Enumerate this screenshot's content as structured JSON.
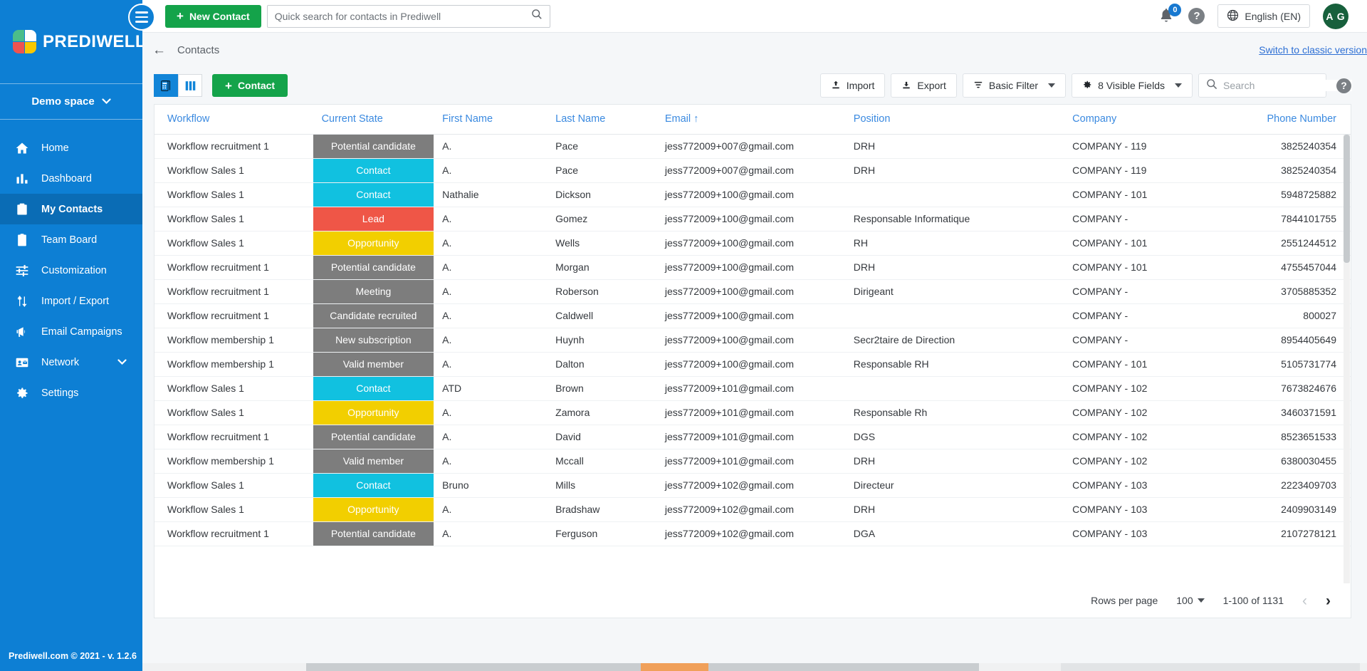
{
  "brand": {
    "name": "PREDIWELL",
    "space": "Demo space",
    "version": "Prediwell.com © 2021 - v. 1.2.6"
  },
  "topbar": {
    "new_contact_label": "New Contact",
    "quick_search_placeholder": "Quick search for contacts in Prediwell",
    "notification_count": "0",
    "help_label": "?",
    "language": "English (EN)",
    "avatar_initials": "A G"
  },
  "breadcrumb": {
    "label": "Contacts",
    "classic_link": "Switch to classic version"
  },
  "sidebar": {
    "items": [
      {
        "label": "Home",
        "icon": "home-icon",
        "active": false
      },
      {
        "label": "Dashboard",
        "icon": "chart-bar-icon",
        "active": false
      },
      {
        "label": "My Contacts",
        "icon": "contacts-board-icon",
        "active": true
      },
      {
        "label": "Team Board",
        "icon": "clipboard-icon",
        "active": false
      },
      {
        "label": "Customization",
        "icon": "sliders-icon",
        "active": false
      },
      {
        "label": "Import / Export",
        "icon": "import-export-icon",
        "active": false
      },
      {
        "label": "Email Campaigns",
        "icon": "megaphone-icon",
        "active": false
      },
      {
        "label": "Network",
        "icon": "contact-card-icon",
        "active": false,
        "caret": true
      },
      {
        "label": "Settings",
        "icon": "gear-icon",
        "active": false
      }
    ]
  },
  "toolbar": {
    "add_contact_label": "Contact",
    "import_label": "Import",
    "export_label": "Export",
    "basic_filter_label": "Basic Filter",
    "visible_fields_label": "8 Visible Fields",
    "search_placeholder": "Search",
    "help_label": "?"
  },
  "table": {
    "columns": [
      {
        "key": "workflow",
        "label": "Workflow"
      },
      {
        "key": "state",
        "label": "Current State"
      },
      {
        "key": "first",
        "label": "First Name"
      },
      {
        "key": "last",
        "label": "Last Name"
      },
      {
        "key": "email",
        "label": "Email",
        "sort": "↑"
      },
      {
        "key": "position",
        "label": "Position"
      },
      {
        "key": "company",
        "label": "Company"
      },
      {
        "key": "phone",
        "label": "Phone Number"
      }
    ],
    "state_colors": {
      "Potential candidate": "#7d7d7d",
      "Contact": "#11c1e0",
      "Lead": "#ef5647",
      "Opportunity": "#f2cf00",
      "Meeting": "#7d7d7d",
      "Candidate recruited": "#7d7d7d",
      "New subscription": "#7d7d7d",
      "Valid member": "#7d7d7d"
    },
    "rows": [
      {
        "workflow": "Workflow recruitment 1",
        "state": "Potential candidate",
        "state_class": "gray",
        "first": "A.",
        "last": "Pace",
        "email": "jess772009+007@gmail.com",
        "position": "DRH",
        "company": "COMPANY - 119",
        "phone": "3825240354"
      },
      {
        "workflow": "Workflow Sales 1",
        "state": "Contact",
        "state_class": "cyan",
        "first": "A.",
        "last": "Pace",
        "email": "jess772009+007@gmail.com",
        "position": "DRH",
        "company": "COMPANY - 119",
        "phone": "3825240354"
      },
      {
        "workflow": "Workflow Sales 1",
        "state": "Contact",
        "state_class": "cyan",
        "first": "Nathalie",
        "last": "Dickson",
        "email": "jess772009+100@gmail.com",
        "position": "",
        "company": "COMPANY - 101",
        "phone": "5948725882"
      },
      {
        "workflow": "Workflow Sales 1",
        "state": "Lead",
        "state_class": "red",
        "first": "A.",
        "last": "Gomez",
        "email": "jess772009+100@gmail.com",
        "position": "Responsable Informatique",
        "company": "COMPANY - ",
        "phone": "7844101755"
      },
      {
        "workflow": "Workflow Sales 1",
        "state": "Opportunity",
        "state_class": "yellow",
        "first": "A.",
        "last": "Wells",
        "email": "jess772009+100@gmail.com",
        "position": "RH",
        "company": "COMPANY - 101",
        "phone": "2551244512"
      },
      {
        "workflow": "Workflow recruitment 1",
        "state": "Potential candidate",
        "state_class": "gray",
        "first": "A.",
        "last": "Morgan",
        "email": "jess772009+100@gmail.com",
        "position": "DRH",
        "company": "COMPANY - 101",
        "phone": "4755457044"
      },
      {
        "workflow": "Workflow recruitment 1",
        "state": "Meeting",
        "state_class": "gray",
        "first": "A.",
        "last": "Roberson",
        "email": "jess772009+100@gmail.com",
        "position": "Dirigeant",
        "company": "COMPANY - ",
        "phone": "3705885352"
      },
      {
        "workflow": "Workflow recruitment 1",
        "state": "Candidate recruited",
        "state_class": "gray",
        "first": "A.",
        "last": "Caldwell",
        "email": "jess772009+100@gmail.com",
        "position": "",
        "company": "COMPANY - ",
        "phone": "800027"
      },
      {
        "workflow": "Workflow membership 1",
        "state": "New subscription",
        "state_class": "gray",
        "first": "A.",
        "last": "Huynh",
        "email": "jess772009+100@gmail.com",
        "position": "Secr2taire de Direction",
        "company": "COMPANY - ",
        "phone": "8954405649"
      },
      {
        "workflow": "Workflow membership 1",
        "state": "Valid member",
        "state_class": "gray",
        "first": "A.",
        "last": "Dalton",
        "email": "jess772009+100@gmail.com",
        "position": "Responsable RH",
        "company": "COMPANY - 101",
        "phone": "5105731774"
      },
      {
        "workflow": "Workflow Sales 1",
        "state": "Contact",
        "state_class": "cyan",
        "first": "ATD",
        "last": "Brown",
        "email": "jess772009+101@gmail.com",
        "position": "",
        "company": "COMPANY - 102",
        "phone": "7673824676"
      },
      {
        "workflow": "Workflow Sales 1",
        "state": "Opportunity",
        "state_class": "yellow",
        "first": "A.",
        "last": "Zamora",
        "email": "jess772009+101@gmail.com",
        "position": "Responsable Rh",
        "company": "COMPANY - 102",
        "phone": "3460371591"
      },
      {
        "workflow": "Workflow recruitment 1",
        "state": "Potential candidate",
        "state_class": "gray",
        "first": "A.",
        "last": "David",
        "email": "jess772009+101@gmail.com",
        "position": "DGS",
        "company": "COMPANY - 102",
        "phone": "8523651533"
      },
      {
        "workflow": "Workflow membership 1",
        "state": "Valid member",
        "state_class": "gray",
        "first": "A.",
        "last": "Mccall",
        "email": "jess772009+101@gmail.com",
        "position": "DRH",
        "company": "COMPANY - 102",
        "phone": "6380030455"
      },
      {
        "workflow": "Workflow Sales 1",
        "state": "Contact",
        "state_class": "cyan",
        "first": "Bruno",
        "last": "Mills",
        "email": "jess772009+102@gmail.com",
        "position": "Directeur",
        "company": "COMPANY - 103",
        "phone": "2223409703"
      },
      {
        "workflow": "Workflow Sales 1",
        "state": "Opportunity",
        "state_class": "yellow",
        "first": "A.",
        "last": "Bradshaw",
        "email": "jess772009+102@gmail.com",
        "position": "DRH",
        "company": "COMPANY - 103",
        "phone": "2409903149"
      },
      {
        "workflow": "Workflow recruitment 1",
        "state": "Potential candidate",
        "state_class": "gray",
        "first": "A.",
        "last": "Ferguson",
        "email": "jess772009+102@gmail.com",
        "position": "DGA",
        "company": "COMPANY - 103",
        "phone": "2107278121"
      }
    ]
  },
  "pagination": {
    "rows_per_page_label": "Rows per page",
    "rows_per_page_value": "100",
    "range_label": "1-100 of 1131",
    "prev_icon": "‹",
    "next_icon": "›"
  },
  "colors": {
    "sidebar": "#0d7fd4",
    "accent_green": "#14a34a",
    "header_link": "#3b8ae0",
    "avatar": "#17603c"
  }
}
